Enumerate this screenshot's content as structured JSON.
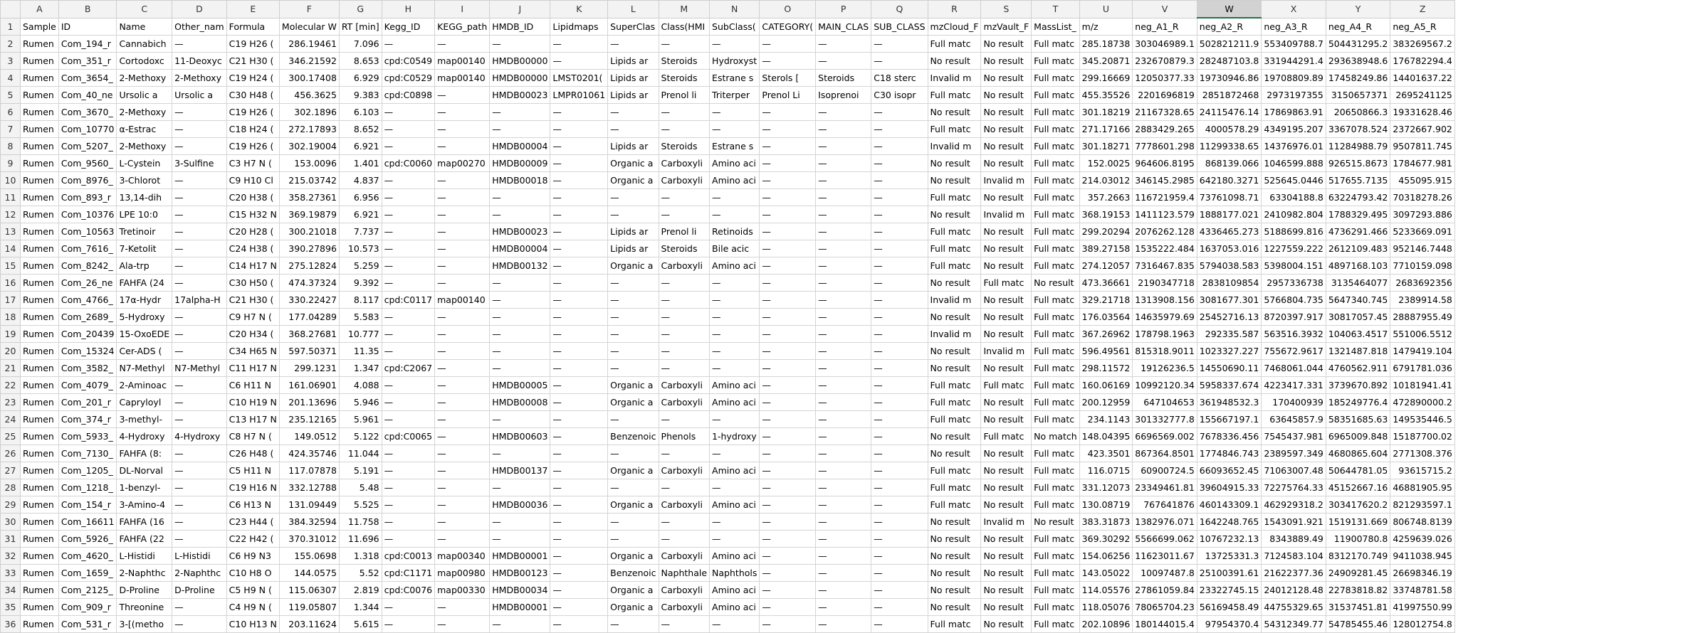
{
  "column_letters": [
    "A",
    "B",
    "C",
    "D",
    "E",
    "F",
    "G",
    "H",
    "I",
    "J",
    "K",
    "L",
    "M",
    "N",
    "O",
    "P",
    "Q",
    "R",
    "S",
    "T",
    "U",
    "V",
    "W",
    "X",
    "Y",
    "Z"
  ],
  "active_column": "W",
  "headers": [
    "Sample",
    "ID",
    "Name",
    "Other_nam",
    "Formula",
    "Molecular W",
    "RT [min]",
    "Kegg_ID",
    "KEGG_path",
    "HMDB_ID",
    "Lipidmaps",
    "SuperClas",
    "Class(HMI",
    "SubClass(",
    "CATEGORY(",
    "MAIN_CLAS",
    "SUB_CLASS",
    "mzCloud_F",
    "mzVault_F",
    "MassList_",
    "m/z",
    "neg_A1_R",
    "neg_A2_R",
    "neg_A3_R",
    "neg_A4_R",
    "neg_A5_R"
  ],
  "rows": [
    [
      "Rumen",
      "Com_194_r",
      "Cannabich",
      "—",
      "C19 H26 (",
      "286.19461",
      "7.096",
      "—",
      "—",
      "—",
      "—",
      "—",
      "—",
      "—",
      "—",
      "—",
      "—",
      "Full matc",
      "No result",
      "Full matc",
      "285.18738",
      "303046989.1",
      "502821211.9",
      "553409788.7",
      "504431295.2",
      "383269567.2"
    ],
    [
      "Rumen",
      "Com_351_r",
      "Cortodoxc",
      "11-Deoxyc",
      "C21 H30 (",
      "346.21592",
      "8.653",
      "cpd:C0549",
      "map00140",
      "HMDB00000",
      "—",
      "Lipids ar",
      "Steroids",
      "Hydroxyst",
      "—",
      "—",
      "—",
      "No result",
      "No result",
      "Full matc",
      "345.20871",
      "232670879.3",
      "282487103.8",
      "331944291.4",
      "293638948.6",
      "176782294.4"
    ],
    [
      "Rumen",
      "Com_3654_",
      "2-Methoxy",
      "2-Methoxy",
      "C19 H24 (",
      "300.17408",
      "6.929",
      "cpd:C0529",
      "map00140",
      "HMDB00000",
      "LMST0201(",
      "Lipids ar",
      "Steroids",
      "Estrane s",
      "Sterols [",
      "Steroids",
      "C18 sterc",
      "Invalid m",
      "No result",
      "Full matc",
      "299.16669",
      "12050377.33",
      "19730946.86",
      "19708809.89",
      "17458249.86",
      "14401637.22"
    ],
    [
      "Rumen",
      "Com_40_ne",
      "Ursolic a",
      "Ursolic a",
      "C30 H48 (",
      "456.3625",
      "9.383",
      "cpd:C0898",
      "—",
      "HMDB00023",
      "LMPR01061",
      "Lipids ar",
      "Prenol li",
      "Triterper",
      "Prenol Li",
      "Isoprenoi",
      "C30 isopr",
      "Full matc",
      "No result",
      "Full matc",
      "455.35526",
      "2201696819",
      "2851872468",
      "2973197355",
      "3150657371",
      "2695241125"
    ],
    [
      "Rumen",
      "Com_3670_",
      "2-Methoxy",
      "—",
      "C19 H26 (",
      "302.1896",
      "6.103",
      "—",
      "—",
      "—",
      "—",
      "—",
      "—",
      "—",
      "—",
      "—",
      "—",
      "No result",
      "No result",
      "Full matc",
      "301.18219",
      "21167328.65",
      "24115476.14",
      "17869863.91",
      "20650866.3",
      "19331628.46"
    ],
    [
      "Rumen",
      "Com_10770",
      "α-Estrac",
      "—",
      "C18 H24 (",
      "272.17893",
      "8.652",
      "—",
      "—",
      "—",
      "—",
      "—",
      "—",
      "—",
      "—",
      "—",
      "—",
      "Full matc",
      "No result",
      "Full matc",
      "271.17166",
      "2883429.265",
      "4000578.29",
      "4349195.207",
      "3367078.524",
      "2372667.902"
    ],
    [
      "Rumen",
      "Com_5207_",
      "2-Methoxy",
      "—",
      "C19 H26 (",
      "302.19004",
      "6.921",
      "—",
      "—",
      "HMDB00004",
      "—",
      "Lipids ar",
      "Steroids",
      "Estrane s",
      "—",
      "—",
      "—",
      "Invalid m",
      "No result",
      "Full matc",
      "301.18271",
      "7778601.298",
      "11299338.65",
      "14376976.01",
      "11284988.79",
      "9507811.745"
    ],
    [
      "Rumen",
      "Com_9560_",
      "L-Cystein",
      "3-Sulfine",
      "C3 H7 N (",
      "153.0096",
      "1.401",
      "cpd:C0060",
      "map00270",
      "HMDB00009",
      "—",
      "Organic a",
      "Carboxyli",
      "Amino aci",
      "—",
      "—",
      "—",
      "No result",
      "No result",
      "Full matc",
      "152.0025",
      "964606.8195",
      "868139.066",
      "1046599.888",
      "926515.8673",
      "1784677.981"
    ],
    [
      "Rumen",
      "Com_8976_",
      "3-Chlorot",
      "—",
      "C9 H10 Cl",
      "215.03742",
      "4.837",
      "—",
      "—",
      "HMDB00018",
      "—",
      "Organic a",
      "Carboxyli",
      "Amino aci",
      "—",
      "—",
      "—",
      "No result",
      "Invalid m",
      "Full matc",
      "214.03012",
      "346145.2985",
      "642180.3271",
      "525645.0446",
      "517655.7135",
      "455095.915"
    ],
    [
      "Rumen",
      "Com_893_r",
      "13,14-dih",
      "—",
      "C20 H38 (",
      "358.27361",
      "6.956",
      "—",
      "—",
      "—",
      "—",
      "—",
      "—",
      "—",
      "—",
      "—",
      "—",
      "Full matc",
      "No result",
      "Full matc",
      "357.2663",
      "116721959.4",
      "73761098.71",
      "63304188.8",
      "63224793.42",
      "70318278.26"
    ],
    [
      "Rumen",
      "Com_10376",
      "LPE 10:0",
      "—",
      "C15 H32 N",
      "369.19879",
      "6.921",
      "—",
      "—",
      "—",
      "—",
      "—",
      "—",
      "—",
      "—",
      "—",
      "—",
      "No result",
      "Invalid m",
      "Full matc",
      "368.19153",
      "1411123.579",
      "1888177.021",
      "2410982.804",
      "1788329.495",
      "3097293.886"
    ],
    [
      "Rumen",
      "Com_10563",
      "Tretinoir",
      "—",
      "C20 H28 (",
      "300.21018",
      "7.737",
      "—",
      "—",
      "HMDB00023",
      "—",
      "Lipids ar",
      "Prenol li",
      "Retinoids",
      "—",
      "—",
      "—",
      "Full matc",
      "No result",
      "Full matc",
      "299.20294",
      "2076262.128",
      "4336465.273",
      "5188699.816",
      "4736291.466",
      "5233669.091"
    ],
    [
      "Rumen",
      "Com_7616_",
      "7-Ketolit",
      "—",
      "C24 H38 (",
      "390.27896",
      "10.573",
      "—",
      "—",
      "HMDB00004",
      "—",
      "Lipids ar",
      "Steroids",
      "Bile acic",
      "—",
      "—",
      "—",
      "Full matc",
      "No result",
      "Full matc",
      "389.27158",
      "1535222.484",
      "1637053.016",
      "1227559.222",
      "2612109.483",
      "952146.7448"
    ],
    [
      "Rumen",
      "Com_8242_",
      "Ala-trp",
      "—",
      "C14 H17 N",
      "275.12824",
      "5.259",
      "—",
      "—",
      "HMDB00132",
      "—",
      "Organic a",
      "Carboxyli",
      "Amino aci",
      "—",
      "—",
      "—",
      "Full matc",
      "No result",
      "Full matc",
      "274.12057",
      "7316467.835",
      "5794038.583",
      "5398004.151",
      "4897168.103",
      "7710159.098"
    ],
    [
      "Rumen",
      "Com_26_ne",
      "FAHFA (24",
      "—",
      "C30 H50 (",
      "474.37324",
      "9.392",
      "—",
      "—",
      "—",
      "—",
      "—",
      "—",
      "—",
      "—",
      "—",
      "—",
      "No result",
      "Full matc",
      "No result",
      "473.36661",
      "2190347718",
      "2838109854",
      "2957336738",
      "3135464077",
      "2683692356"
    ],
    [
      "Rumen",
      "Com_4766_",
      "17α-Hydr",
      "17alpha-H",
      "C21 H30 (",
      "330.22427",
      "8.117",
      "cpd:C0117",
      "map00140",
      "—",
      "—",
      "—",
      "—",
      "—",
      "—",
      "—",
      "—",
      "Invalid m",
      "No result",
      "Full matc",
      "329.21718",
      "1313908.156",
      "3081677.301",
      "5766804.735",
      "5647340.745",
      "2389914.58"
    ],
    [
      "Rumen",
      "Com_2689_",
      "5-Hydroxy",
      "—",
      "C9 H7 N (",
      "177.04289",
      "5.583",
      "—",
      "—",
      "—",
      "—",
      "—",
      "—",
      "—",
      "—",
      "—",
      "—",
      "No result",
      "No result",
      "Full matc",
      "176.03564",
      "14635979.69",
      "25452716.13",
      "8720397.917",
      "30817057.45",
      "28887955.49"
    ],
    [
      "Rumen",
      "Com_20439",
      "15-OxoEDE",
      "—",
      "C20 H34 (",
      "368.27681",
      "10.777",
      "—",
      "—",
      "—",
      "—",
      "—",
      "—",
      "—",
      "—",
      "—",
      "—",
      "Invalid m",
      "No result",
      "Full matc",
      "367.26962",
      "178798.1963",
      "292335.587",
      "563516.3932",
      "104063.4517",
      "551006.5512"
    ],
    [
      "Rumen",
      "Com_15324",
      "Cer-ADS (",
      "—",
      "C34 H65 N",
      "597.50371",
      "11.35",
      "—",
      "—",
      "—",
      "—",
      "—",
      "—",
      "—",
      "—",
      "—",
      "—",
      "No result",
      "Invalid m",
      "Full matc",
      "596.49561",
      "815318.9011",
      "1023327.227",
      "755672.9617",
      "1321487.818",
      "1479419.104"
    ],
    [
      "Rumen",
      "Com_3582_",
      "N7-Methyl",
      "N7-Methyl",
      "C11 H17 N",
      "299.1231",
      "1.347",
      "cpd:C2067",
      "—",
      "—",
      "—",
      "—",
      "—",
      "—",
      "—",
      "—",
      "—",
      "No result",
      "No result",
      "Full matc",
      "298.11572",
      "19126236.5",
      "14550690.11",
      "7468061.044",
      "4760562.911",
      "6791781.036"
    ],
    [
      "Rumen",
      "Com_4079_",
      "2-Aminoac",
      "—",
      "C6 H11 N",
      "161.06901",
      "4.088",
      "—",
      "—",
      "HMDB00005",
      "—",
      "Organic a",
      "Carboxyli",
      "Amino aci",
      "—",
      "—",
      "—",
      "Full matc",
      "Full matc",
      "Full matc",
      "160.06169",
      "10992120.34",
      "5958337.674",
      "4223417.331",
      "3739670.892",
      "10181941.41"
    ],
    [
      "Rumen",
      "Com_201_r",
      "Capryloyl",
      "—",
      "C10 H19 N",
      "201.13696",
      "5.946",
      "—",
      "—",
      "HMDB00008",
      "—",
      "Organic a",
      "Carboxyli",
      "Amino aci",
      "—",
      "—",
      "—",
      "Full matc",
      "No result",
      "Full matc",
      "200.12959",
      "647104653",
      "361948532.3",
      "170400939",
      "185249776.4",
      "472890000.2"
    ],
    [
      "Rumen",
      "Com_374_r",
      "3-methyl-",
      "—",
      "C13 H17 N",
      "235.12165",
      "5.961",
      "—",
      "—",
      "—",
      "—",
      "—",
      "—",
      "—",
      "—",
      "—",
      "—",
      "Full matc",
      "No result",
      "Full matc",
      "234.1143",
      "301332777.8",
      "155667197.1",
      "63645857.9",
      "58351685.63",
      "149535446.5"
    ],
    [
      "Rumen",
      "Com_5933_",
      "4-Hydroxy",
      "4-Hydroxy",
      "C8 H7 N (",
      "149.0512",
      "5.122",
      "cpd:C0065",
      "—",
      "HMDB00603",
      "—",
      "Benzenoic",
      "Phenols",
      "1-hydroxy",
      "—",
      "—",
      "—",
      "No result",
      "Full matc",
      "No match",
      "148.04395",
      "6696569.002",
      "7678336.456",
      "7545437.981",
      "6965009.848",
      "15187700.02"
    ],
    [
      "Rumen",
      "Com_7130_",
      "FAHFA (8:",
      "—",
      "C26 H48 (",
      "424.35746",
      "11.044",
      "—",
      "—",
      "—",
      "—",
      "—",
      "—",
      "—",
      "—",
      "—",
      "—",
      "No result",
      "No result",
      "Full matc",
      "423.3501",
      "867364.8501",
      "1774846.743",
      "2389597.349",
      "4680865.604",
      "2771308.376"
    ],
    [
      "Rumen",
      "Com_1205_",
      "DL-Norval",
      "—",
      "C5 H11 N",
      "117.07878",
      "5.191",
      "—",
      "—",
      "HMDB00137",
      "—",
      "Organic a",
      "Carboxyli",
      "Amino aci",
      "—",
      "—",
      "—",
      "Full matc",
      "No result",
      "Full matc",
      "116.0715",
      "60900724.5",
      "66093652.45",
      "71063007.48",
      "50644781.05",
      "93615715.2"
    ],
    [
      "Rumen",
      "Com_1218_",
      "1-benzyl-",
      "—",
      "C19 H16 N",
      "332.12788",
      "5.48",
      "—",
      "—",
      "—",
      "—",
      "—",
      "—",
      "—",
      "—",
      "—",
      "—",
      "Full matc",
      "No result",
      "Full matc",
      "331.12073",
      "23349461.81",
      "39604915.33",
      "72275764.33",
      "45152667.16",
      "46881905.95"
    ],
    [
      "Rumen",
      "Com_154_r",
      "3-Amino-4",
      "—",
      "C6 H13 N",
      "131.09449",
      "5.525",
      "—",
      "—",
      "HMDB00036",
      "—",
      "Organic a",
      "Carboxyli",
      "Amino aci",
      "—",
      "—",
      "—",
      "Full matc",
      "No result",
      "Full matc",
      "130.08719",
      "767641876",
      "460143309.1",
      "462929318.2",
      "303417620.2",
      "821293597.1"
    ],
    [
      "Rumen",
      "Com_16611",
      "FAHFA (16",
      "—",
      "C23 H44 (",
      "384.32594",
      "11.758",
      "—",
      "—",
      "—",
      "—",
      "—",
      "—",
      "—",
      "—",
      "—",
      "—",
      "No result",
      "Invalid m",
      "No result",
      "383.31873",
      "1382976.071",
      "1642248.765",
      "1543091.921",
      "1519131.669",
      "806748.8139"
    ],
    [
      "Rumen",
      "Com_5926_",
      "FAHFA (22",
      "—",
      "C22 H42 (",
      "370.31012",
      "11.696",
      "—",
      "—",
      "—",
      "—",
      "—",
      "—",
      "—",
      "—",
      "—",
      "—",
      "No result",
      "No result",
      "Full matc",
      "369.30292",
      "5566699.062",
      "10767232.13",
      "8343889.49",
      "11900780.8",
      "4259639.026"
    ],
    [
      "Rumen",
      "Com_4620_",
      "L-Histidi",
      "L-Histidi",
      "C6 H9 N3",
      "155.0698",
      "1.318",
      "cpd:C0013",
      "map00340",
      "HMDB00001",
      "—",
      "Organic a",
      "Carboxyli",
      "Amino aci",
      "—",
      "—",
      "—",
      "No result",
      "No result",
      "Full matc",
      "154.06256",
      "11623011.67",
      "13725331.3",
      "7124583.104",
      "8312170.749",
      "9411038.945"
    ],
    [
      "Rumen",
      "Com_1659_",
      "2-Naphthc",
      "2-Naphthc",
      "C10 H8 O",
      "144.0575",
      "5.52",
      "cpd:C1171",
      "map00980",
      "HMDB00123",
      "—",
      "Benzenoic",
      "Naphthale",
      "Naphthols",
      "—",
      "—",
      "—",
      "No result",
      "No result",
      "Full matc",
      "143.05022",
      "10097487.8",
      "25100391.61",
      "21622377.36",
      "24909281.45",
      "26698346.19"
    ],
    [
      "Rumen",
      "Com_2125_",
      "D-Proline",
      "D-Proline",
      "C5 H9 N (",
      "115.06307",
      "2.819",
      "cpd:C0076",
      "map00330",
      "HMDB00034",
      "—",
      "Organic a",
      "Carboxyli",
      "Amino aci",
      "—",
      "—",
      "—",
      "No result",
      "No result",
      "Full matc",
      "114.05576",
      "27861059.84",
      "23322745.15",
      "24012128.48",
      "22783818.82",
      "33748781.58"
    ],
    [
      "Rumen",
      "Com_909_r",
      "Threonine",
      "—",
      "C4 H9 N (",
      "119.05807",
      "1.344",
      "—",
      "—",
      "HMDB00001",
      "—",
      "Organic a",
      "Carboxyli",
      "Amino aci",
      "—",
      "—",
      "—",
      "No result",
      "No result",
      "Full matc",
      "118.05076",
      "78065704.23",
      "56169458.49",
      "44755329.65",
      "31537451.81",
      "41997550.99"
    ],
    [
      "Rumen",
      "Com_531_r",
      "3-[(metho",
      "—",
      "C10 H13 N",
      "203.11624",
      "5.615",
      "—",
      "—",
      "—",
      "—",
      "—",
      "—",
      "—",
      "—",
      "—",
      "—",
      "Full matc",
      "No result",
      "Full matc",
      "202.10896",
      "180144015.4",
      "97954370.4",
      "54312349.77",
      "54785455.46",
      "128012754.8"
    ]
  ]
}
